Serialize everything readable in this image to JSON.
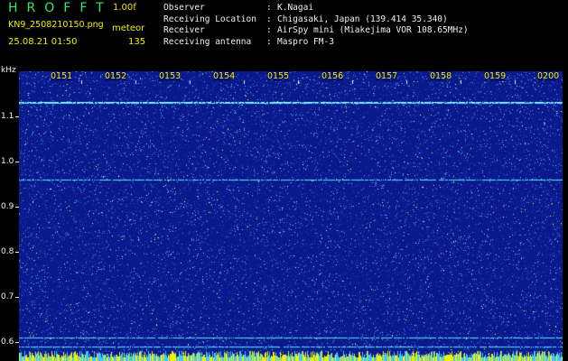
{
  "header": {
    "app_title": "HROFFT",
    "version": "1.00f",
    "filename": "KN9_2508210150.png",
    "mode": "meteor",
    "datetime": "25.08.21 01:50",
    "count": "135"
  },
  "info": [
    {
      "key": "Observer",
      "value": "K.Nagai"
    },
    {
      "key": "Receiving Location",
      "value": "Chigasaki, Japan (139.414 35.340)"
    },
    {
      "key": "Receiver",
      "value": "AirSpy mini (Miakejima VOR 108.65MHz)"
    },
    {
      "key": "Receiving antenna",
      "value": "Maspro FM-3"
    }
  ],
  "axis": {
    "unit": "kHz",
    "y_labels": [
      "1.1",
      "1.0",
      "0.9",
      "0.8",
      "0.7",
      "0.6"
    ],
    "x_labels": [
      "0151",
      "0152",
      "0153",
      "0154",
      "0155",
      "0156",
      "0157",
      "0158",
      "0159",
      "0200"
    ]
  },
  "colors": {
    "background": "#0a1a8c",
    "noise_light": "#60d0ff",
    "noise_bright": "#ffff60",
    "signal_line": "#4ee8ff",
    "baseline": "#f0f000",
    "label": "#f0f000"
  },
  "spectrogram": {
    "freq_range_khz": [
      0.58,
      1.17
    ],
    "horizontal_signals_khz": [
      1.108,
      1.105,
      0.95,
      0.627,
      0.61
    ]
  }
}
